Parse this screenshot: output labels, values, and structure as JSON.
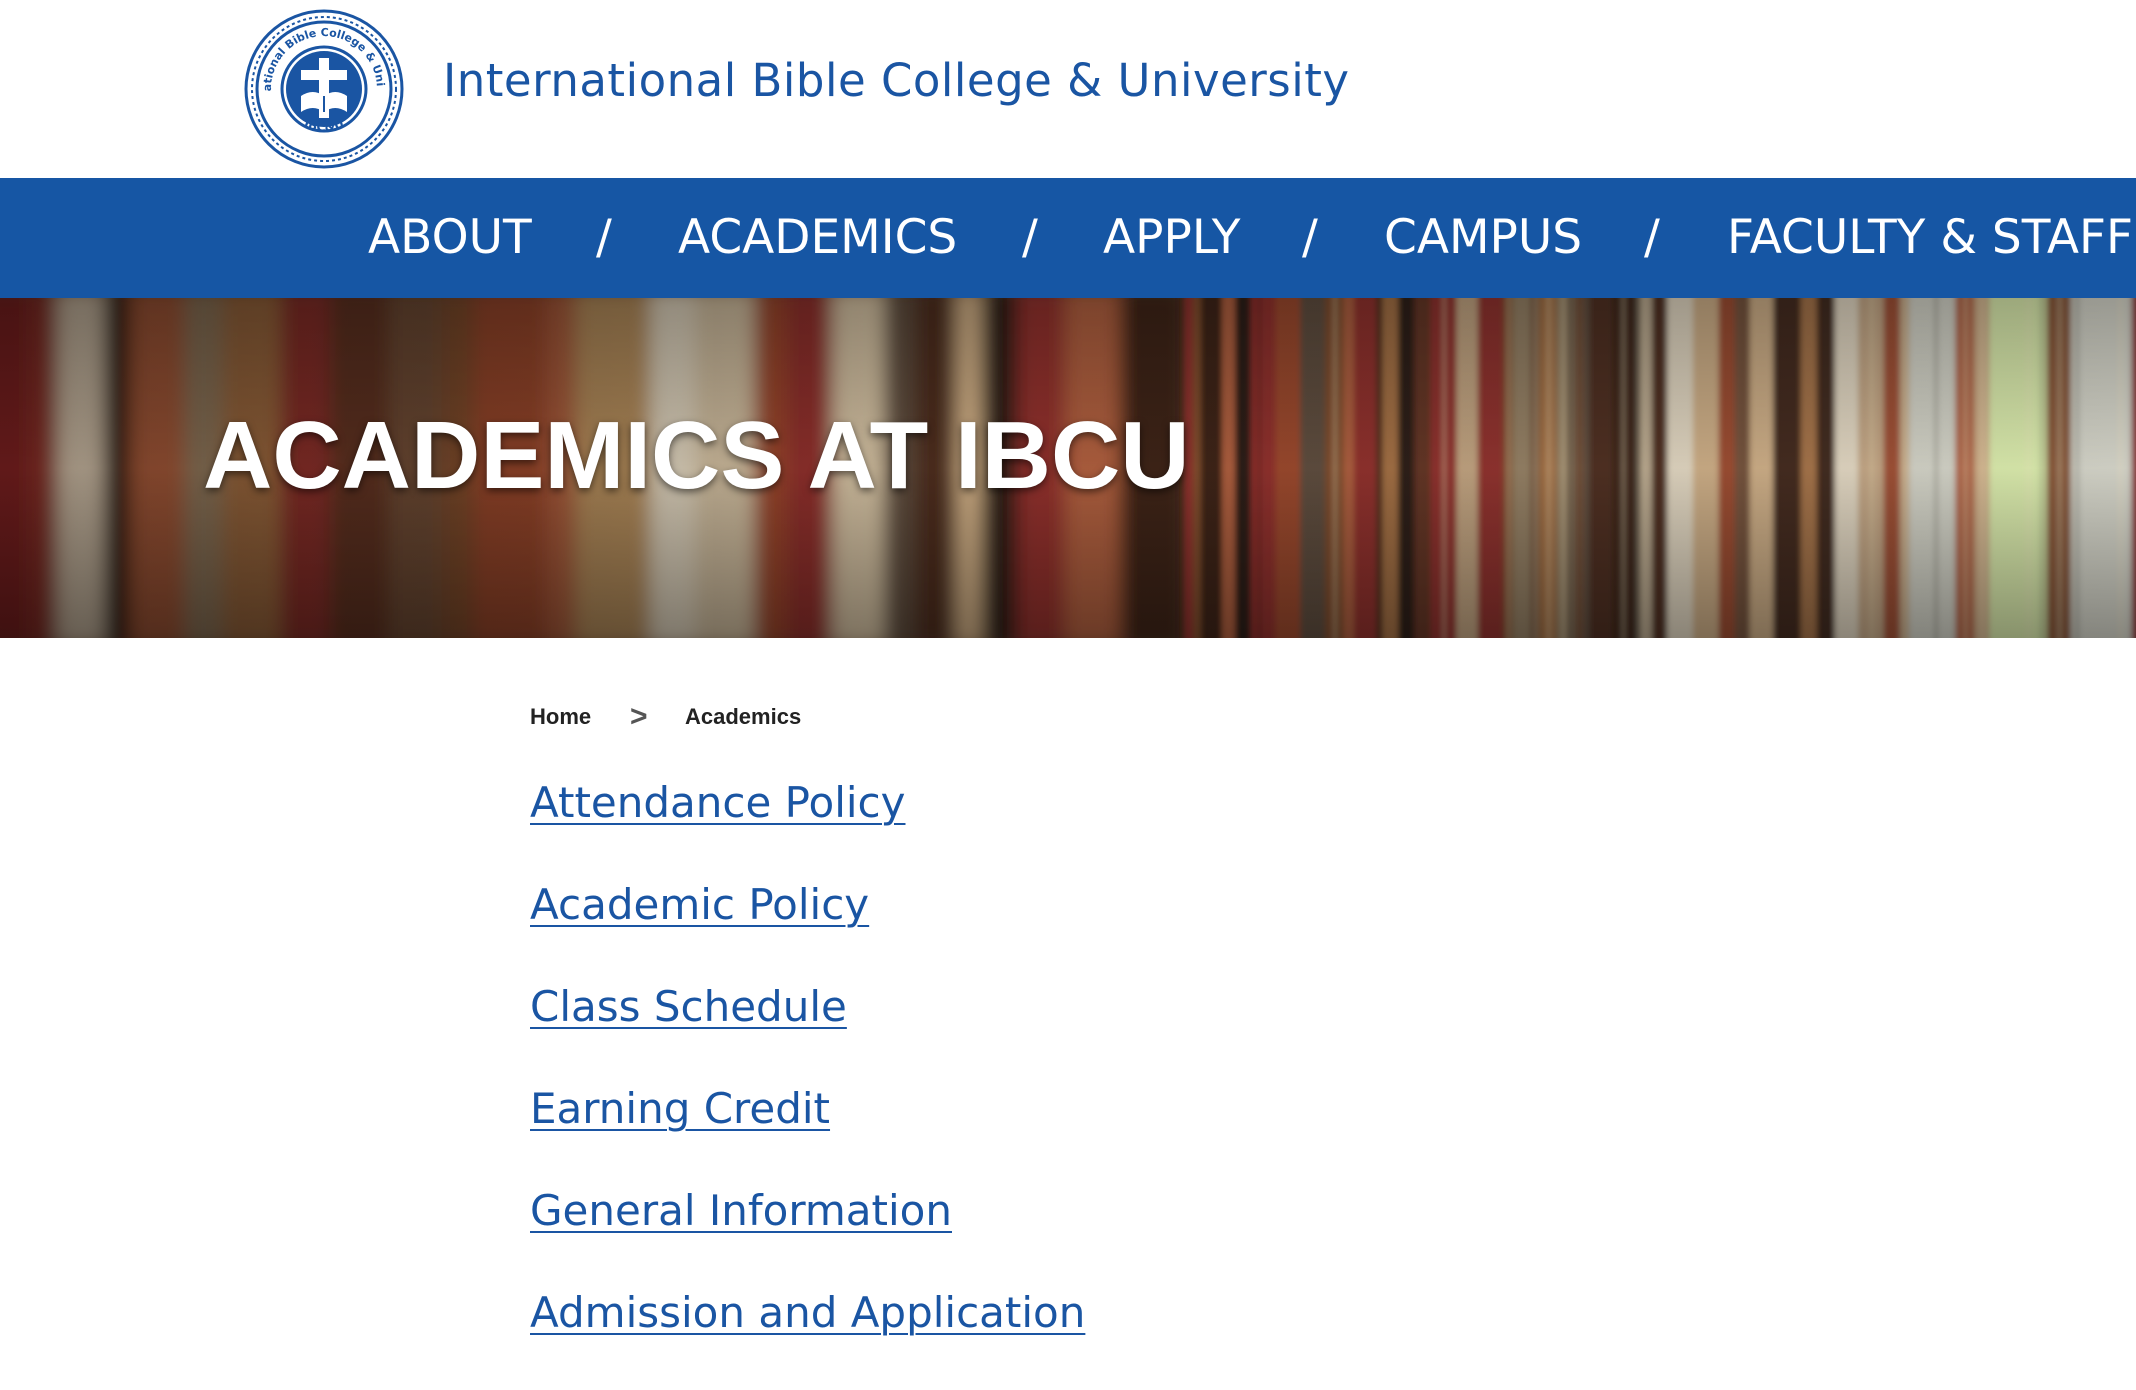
{
  "header": {
    "site_title": "International Bible College & University",
    "logo": {
      "ring_top_text": "International Bible College & University",
      "ring_bottom_text": "IBC&U",
      "color": "#1a55a3"
    }
  },
  "nav": {
    "background": "#1656a4",
    "separator": "/",
    "items": [
      {
        "label": "ABOUT"
      },
      {
        "label": "ACADEMICS"
      },
      {
        "label": "APPLY"
      },
      {
        "label": "CAMPUS"
      },
      {
        "label": "FACULTY & STAFF"
      }
    ]
  },
  "hero": {
    "title": "ACADEMICS AT IBCU",
    "background": "bookshelf-photo"
  },
  "breadcrumb": {
    "home": "Home",
    "separator": ">",
    "current": "Academics"
  },
  "links": [
    {
      "label": "Attendance Policy"
    },
    {
      "label": "Academic Policy"
    },
    {
      "label": "Class Schedule"
    },
    {
      "label": "Earning Credit"
    },
    {
      "label": "General Information"
    },
    {
      "label": "Admission and Application"
    }
  ],
  "colors": {
    "brand_blue": "#1a55a3",
    "nav_blue": "#1656a4",
    "text_dark": "#222222"
  }
}
